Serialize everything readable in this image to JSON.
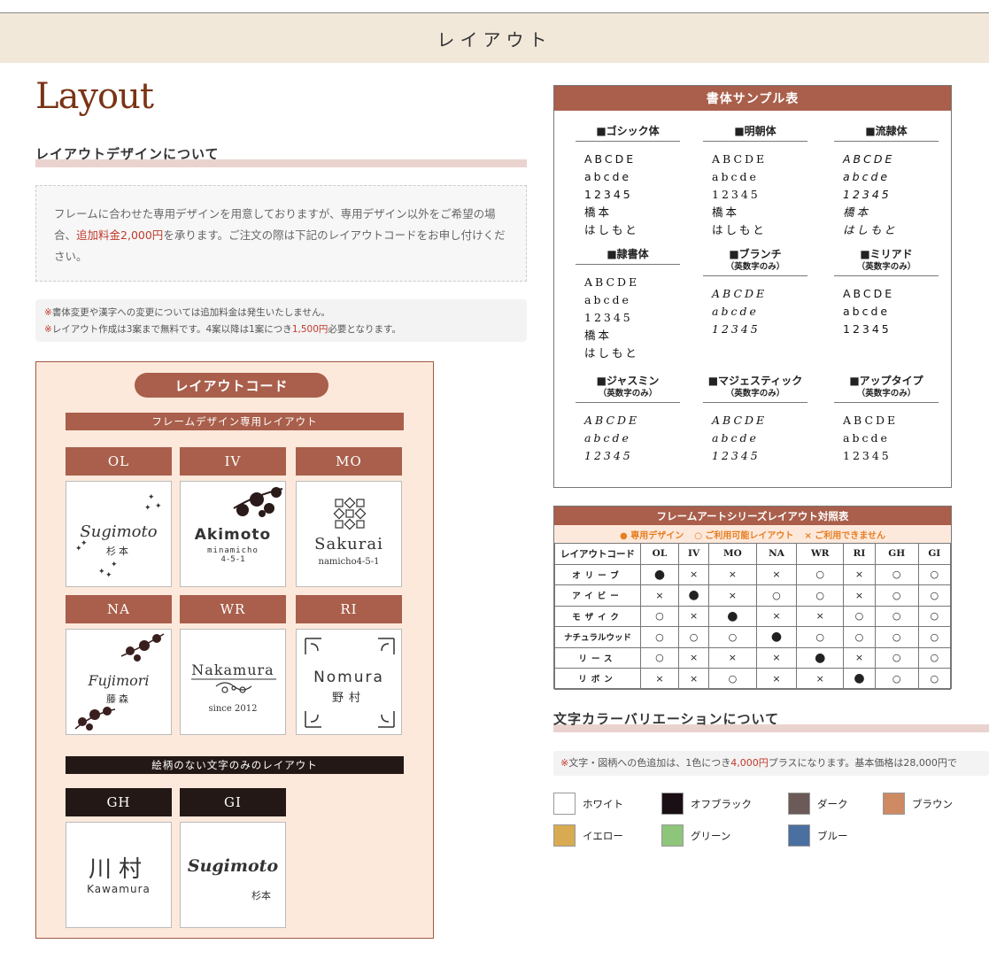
{
  "page_title": "レイアウト",
  "layout_word": "Layout",
  "design_section": {
    "title": "レイアウトデザインについて",
    "info_part1": "フレームに合わせた専用デザインを用意しておりますが、専用デザイン以外をご希望の場合、",
    "info_highlight": "追加料金2,000円",
    "info_part2": "を承ります。ご注文の際は下記のレイアウトコードをお申し付けください。",
    "note1_mark": "※",
    "note1": "書体変更や漢字への変更については追加料金は発生いたしません。",
    "note2_mark": "※",
    "note2_a": "レイアウト作成は3案まで無料です。4案以降は1案につき",
    "note2_price": "1,500円",
    "note2_b": "必要となります。"
  },
  "layout_code": {
    "title": "レイアウトコード",
    "frame_band": "フレームデザイン専用レイアウト",
    "text_band": "絵柄のない文字のみのレイアウト",
    "codes": [
      {
        "code": "OL",
        "name": "Sugimoto",
        "sub": "杉本"
      },
      {
        "code": "IV",
        "name": "Akimoto",
        "sub": "minamicho",
        "sub2": "4-5-1"
      },
      {
        "code": "MO",
        "name": "Sakurai",
        "sub": "namicho4-5-1"
      },
      {
        "code": "NA",
        "name": "Fujimori",
        "sub": "藤森"
      },
      {
        "code": "WR",
        "name": "Nakamura",
        "sub": "since 2012"
      },
      {
        "code": "RI",
        "name": "Nomura",
        "sub": "野村"
      },
      {
        "code": "GH",
        "name": "川村",
        "sub": "Kawamura"
      },
      {
        "code": "GI",
        "name": "Sugimoto",
        "sub": "杉本"
      }
    ]
  },
  "font_samples": {
    "title": "書体サンプル表",
    "fonts": [
      {
        "name": "■ゴシック体",
        "sub": "",
        "lines": [
          "ABCDE",
          "abcde",
          "12345",
          "橋本",
          "はしもと"
        ]
      },
      {
        "name": "■明朝体",
        "sub": "",
        "lines": [
          "ABCDE",
          "abcde",
          "12345",
          "橋本",
          "はしもと"
        ]
      },
      {
        "name": "■流隷体",
        "sub": "",
        "lines": [
          "ABCDE",
          "abcde",
          "12345",
          "橋本",
          "はしもと"
        ]
      },
      {
        "name": "■隷書体",
        "sub": "",
        "lines": [
          "ABCDE",
          "abcde",
          "12345",
          "橋本",
          "はしもと"
        ]
      },
      {
        "name": "■ブランチ",
        "sub": "（英数字のみ）",
        "lines": [
          "ABCDE",
          "abcde",
          "12345"
        ]
      },
      {
        "name": "■ミリアド",
        "sub": "（英数字のみ）",
        "lines": [
          "ABCDE",
          "abcde",
          "12345"
        ]
      },
      {
        "name": "■ジャスミン",
        "sub": "（英数字のみ）",
        "lines": [
          "ABCDE",
          "abcde",
          "12345"
        ]
      },
      {
        "name": "■マジェスティック",
        "sub": "（英数字のみ）",
        "lines": [
          "ABCDE",
          "abcde",
          "12345"
        ]
      },
      {
        "name": "■アップタイプ",
        "sub": "（英数字のみ）",
        "lines": [
          "ABCDE",
          "abcde",
          "12345"
        ]
      }
    ]
  },
  "ref_table": {
    "title": "フレームアートシリーズレイアウト対照表",
    "legend": [
      "● 専用デザイン",
      "○ ご利用可能レイアウト",
      "× ご利用できません"
    ],
    "header_label": "レイアウトコード",
    "columns": [
      "OL",
      "IV",
      "MO",
      "NA",
      "WR",
      "RI",
      "GH",
      "GI"
    ],
    "rows": [
      {
        "label": "オリーブ",
        "cells": [
          "●",
          "×",
          "×",
          "×",
          "○",
          "×",
          "○",
          "○"
        ]
      },
      {
        "label": "アイビー",
        "cells": [
          "×",
          "●",
          "×",
          "○",
          "○",
          "×",
          "○",
          "○"
        ]
      },
      {
        "label": "モザイク",
        "cells": [
          "○",
          "×",
          "●",
          "×",
          "×",
          "○",
          "○",
          "○"
        ]
      },
      {
        "label": "ナチュラルウッド",
        "cells": [
          "○",
          "○",
          "○",
          "●",
          "○",
          "○",
          "○",
          "○"
        ]
      },
      {
        "label": "リース",
        "cells": [
          "○",
          "×",
          "×",
          "×",
          "●",
          "×",
          "○",
          "○"
        ]
      },
      {
        "label": "リボン",
        "cells": [
          "×",
          "×",
          "○",
          "×",
          "×",
          "●",
          "○",
          "○"
        ]
      }
    ]
  },
  "color_section": {
    "title": "文字カラーバリエーションについて",
    "note_mark": "※",
    "note_a": "文字・図柄への色追加は、1色につき",
    "note_price": "4,000円",
    "note_b": "プラスになります。基本価格は28,000円で",
    "colors": [
      {
        "name": "ホワイト",
        "hex": "#ffffff"
      },
      {
        "name": "オフブラック",
        "hex": "#1a0f14"
      },
      {
        "name": "ダーク",
        "hex": "#6b5a57"
      },
      {
        "name": "ブラウン",
        "hex": "#cd8a63"
      },
      {
        "name": "イエロー",
        "hex": "#d8aa52"
      },
      {
        "name": "グリーン",
        "hex": "#8dc57b"
      },
      {
        "name": "ブルー",
        "hex": "#4a70a1"
      }
    ]
  },
  "accent_colors": {
    "brown": "#a95f4b",
    "dark": "#231815",
    "pink_bg": "#fde9dc"
  }
}
